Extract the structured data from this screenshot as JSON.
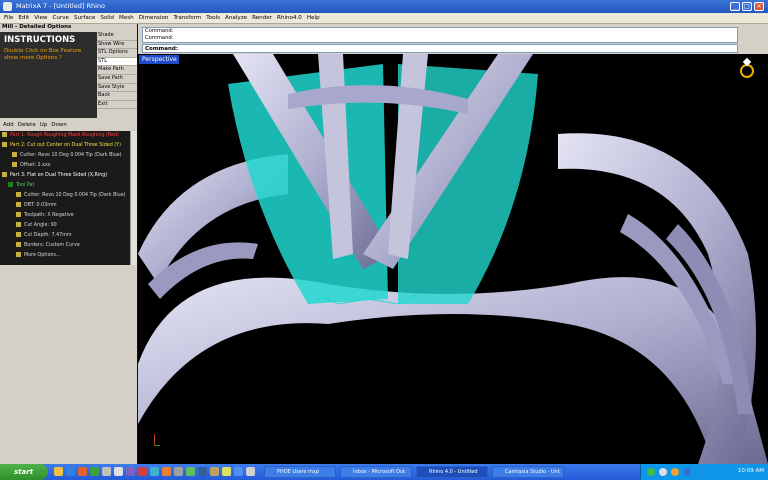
{
  "window": {
    "title": "MatrixA 7 - [Untitled] Rhino",
    "controls": [
      "_",
      "□",
      "×"
    ]
  },
  "menu": [
    "File",
    "Edit",
    "View",
    "Curve",
    "Surface",
    "Solid",
    "Mesh",
    "Dimension",
    "Transform",
    "Tools",
    "Analyze",
    "Render",
    "Rhino4.0",
    "Help"
  ],
  "left_panel": {
    "title": "Mill - Detailed Options",
    "instructions_heading": "INSTRUCTIONS",
    "instructions_text": "Double Click on Box Feature show more Options ?",
    "side_buttons": [
      "Shade",
      "Show Wire",
      "STL Options",
      "STL",
      "Make Path",
      "Save Path",
      "Save Style",
      "Back",
      "Exit"
    ],
    "tree_toolbar": [
      "Add",
      "Delete",
      "Up",
      "Down"
    ],
    "tree": [
      "Part 1: Rough Roughing Mask Roughing (Red)",
      "Part 2: Cut out Center on Dual Three Sided (Y)",
      "Cutter: Revo 10 Deg 0.004 Tip (Dark Blue)",
      "Offset: 2.xxx",
      "Part 3: Flat on Dual Three Sided (X,Ring)",
      "Tool Pat",
      "Cutter: Revo 10 Deg 0.004 Tip (Dark Blue)",
      "DBT: 0.03mm",
      "Toolpath: X Negative",
      "Cut Angle: 90",
      "Cut Depth: 7.47mm",
      "Borders: Custom Curve",
      "More Options..."
    ]
  },
  "command": {
    "history": [
      "Command:",
      "Command:"
    ],
    "prompt": "Command:"
  },
  "viewport": {
    "label": "Perspective"
  },
  "taskbar": {
    "start": "start",
    "tasks": [
      "PHOE Users mxp",
      "Inbox - Microsoft Out",
      "Rhino 4.0 - Untitled",
      "Camtasia Studio - Unt"
    ],
    "time": "10:09 AM"
  },
  "colors": {
    "toolpath": "#20d8d0",
    "ring": "#b8b8d8",
    "accent": "#1e4ac8"
  }
}
